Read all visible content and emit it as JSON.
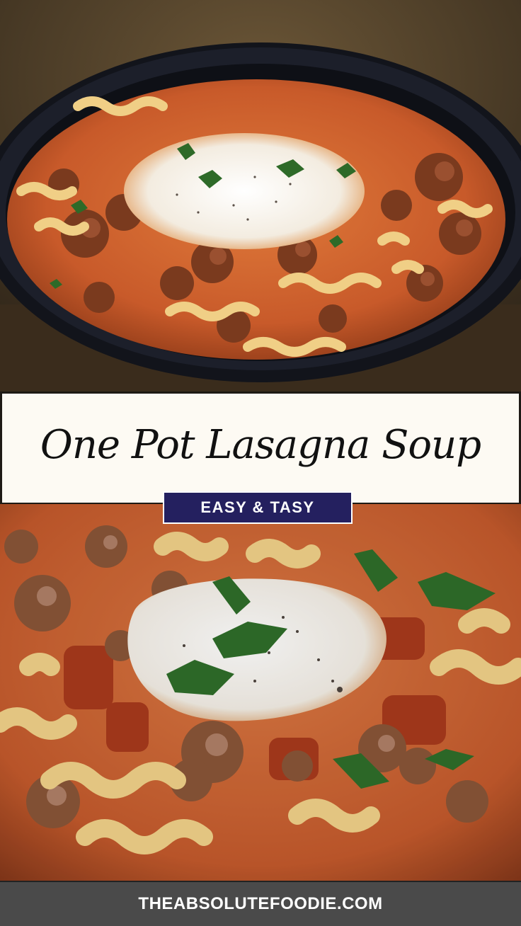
{
  "title_card": {
    "title": "One Pot Lasagna Soup"
  },
  "badge": {
    "label": "EASY & TASY"
  },
  "footer": {
    "site": "THEABSOLUTEFOODIE.COM"
  },
  "colors": {
    "badge_background": "#24205f",
    "title_card_background": "#fdfaf3",
    "footer_background": "#4a4a4a",
    "soup_broth": "#c85a2a",
    "noodle": "#f0cf86",
    "ricotta": "#f6f2ea",
    "parsley": "#2e6a28",
    "bowl": "#1c1f2a"
  },
  "photos": {
    "top_icon": "lasagna-soup-bowl-photo",
    "bottom_icon": "lasagna-soup-closeup-photo"
  }
}
